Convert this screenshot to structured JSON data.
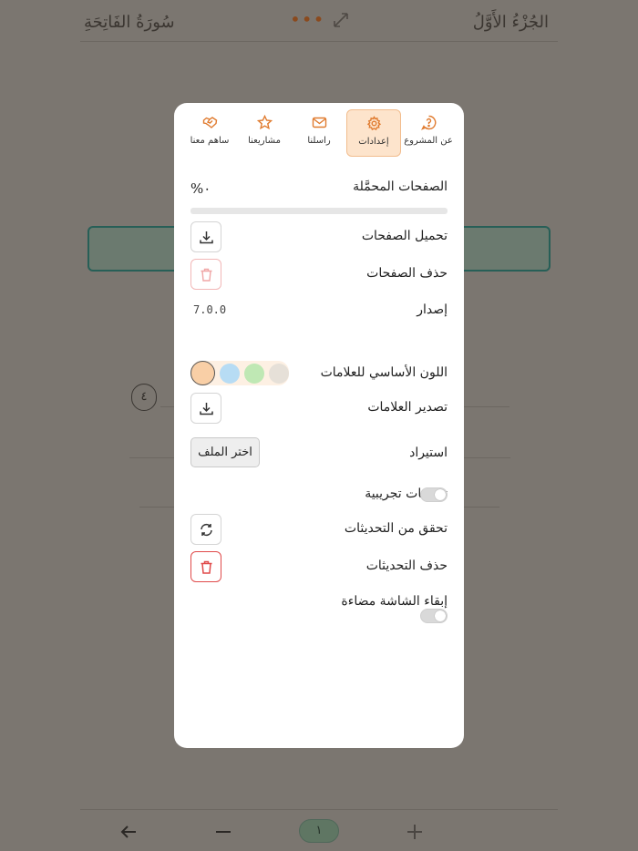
{
  "header": {
    "juz": "الجُزْءُ الأَوَّلُ",
    "surah": "سُورَةُ الفَاتِحَةِ",
    "menu_icon": "more-dots-icon",
    "expand_icon": "expand-icon"
  },
  "page": {
    "ayah_marker": "٤"
  },
  "footer": {
    "page_number": "١",
    "back_icon": "arrow-left-icon",
    "zoom_out_icon": "minus-icon",
    "zoom_in_icon": "plus-icon"
  },
  "tabs": [
    {
      "label": "عن المشروع",
      "icon": "help-bubble-icon",
      "active": false
    },
    {
      "label": "إعدادات",
      "icon": "gear-icon",
      "active": true
    },
    {
      "label": "راسلنا",
      "icon": "mail-icon",
      "active": false
    },
    {
      "label": "مشاريعنا",
      "icon": "star-icon",
      "active": false
    },
    {
      "label": "ساهم معنا",
      "icon": "handshake-icon",
      "active": false
    }
  ],
  "settings": {
    "downloaded_pages_label": "الصفحات المحمَّلة",
    "downloaded_percent": "٠%",
    "download_progress": 0,
    "download_pages_label": "تحميل الصفحات",
    "delete_pages_label": "حذف الصفحات",
    "version_label": "إصدار",
    "version_value": "7.0.0",
    "marker_color_label": "اللون الأساسي للعلامات",
    "marker_colors": [
      "#f9cfa6",
      "#b7dcf4",
      "#bfe8b4",
      "#e6e0d8"
    ],
    "selected_color": "#f9cfa6",
    "export_markers_label": "تصدير العلامات",
    "import_label": "استيراد",
    "choose_file_label": "اختر الملف",
    "beta_updates_label": "تحديثات تجريبية",
    "beta_updates_on": false,
    "check_updates_label": "تحقق من التحديثات",
    "delete_updates_label": "حذف التحديثات",
    "keep_screen_on_label": "إبقاء الشاشة مضاءة",
    "keep_screen_on": false
  },
  "colors": {
    "accent": "#e8853e",
    "active_tab_bg": "#fde4cc",
    "danger": "#e04a4a",
    "overlay": "#7b7670"
  }
}
